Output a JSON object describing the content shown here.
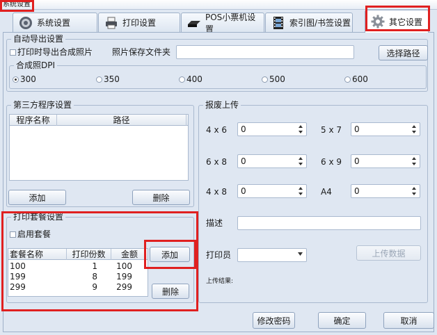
{
  "window": {
    "title": "系统设置"
  },
  "tabs": [
    {
      "label": "系统设置",
      "icon": "gear-disc-icon"
    },
    {
      "label": "打印设置",
      "icon": "printer-icon"
    },
    {
      "label": "POS小票机设置",
      "icon": "receipt-printer-icon"
    },
    {
      "label": "索引图/书签设置",
      "icon": "film-strip-icon"
    },
    {
      "label": "其它设置",
      "icon": "gear-icon",
      "active": true
    }
  ],
  "auto_export": {
    "title": "自动导出设置",
    "export_checkbox_label": "打印时导出合成照片",
    "folder_label": "照片保存文件夹",
    "folder_value": "",
    "choose_path_button": "选择路径",
    "dpi_title": "合成照DPI",
    "dpi_options": [
      "300",
      "350",
      "400",
      "500",
      "600"
    ],
    "dpi_selected": "300"
  },
  "third_party": {
    "title": "第三方程序设置",
    "columns": [
      "程序名称",
      "路径"
    ],
    "add_button": "添加",
    "delete_button": "删除"
  },
  "defect_upload": {
    "title": "报废上传",
    "sizes": [
      {
        "label": "4 x 6",
        "value": "0"
      },
      {
        "label": "5 x 7",
        "value": "0"
      },
      {
        "label": "6 x 8",
        "value": "0"
      },
      {
        "label": "6 x 9",
        "value": "0"
      },
      {
        "label": "4 x 8",
        "value": "0"
      },
      {
        "label": "A4",
        "value": "0"
      }
    ],
    "description_label": "描述",
    "description_value": "",
    "printer_label": "打印员",
    "printer_value": "",
    "upload_button": "上传数据",
    "result_label": "上传结果:"
  },
  "print_package": {
    "title": "打印套餐设置",
    "enable_label": "启用套餐",
    "columns": [
      "套餐名称",
      "打印份数",
      "金额"
    ],
    "rows": [
      {
        "name": "100",
        "copies": "1",
        "amount": "100"
      },
      {
        "name": "199",
        "copies": "8",
        "amount": "199"
      },
      {
        "name": "299",
        "copies": "9",
        "amount": "299"
      }
    ],
    "add_button": "添加",
    "delete_button": "删除"
  },
  "footer": {
    "change_password_button": "修改密码",
    "ok_button": "确定",
    "cancel_button": "取消"
  },
  "colors": {
    "highlight": "#e02020",
    "background": "#dfe7f2",
    "border": "#9eb0c8"
  }
}
